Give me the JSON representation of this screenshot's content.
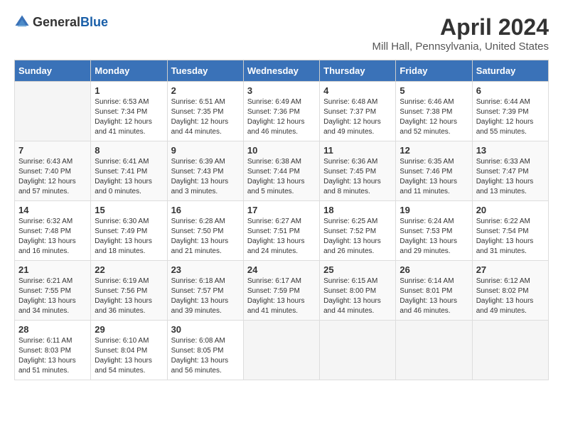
{
  "header": {
    "logo_general": "General",
    "logo_blue": "Blue",
    "title": "April 2024",
    "subtitle": "Mill Hall, Pennsylvania, United States"
  },
  "days_of_week": [
    "Sunday",
    "Monday",
    "Tuesday",
    "Wednesday",
    "Thursday",
    "Friday",
    "Saturday"
  ],
  "weeks": [
    [
      {
        "day": "",
        "sunrise": "",
        "sunset": "",
        "daylight": ""
      },
      {
        "day": "1",
        "sunrise": "Sunrise: 6:53 AM",
        "sunset": "Sunset: 7:34 PM",
        "daylight": "Daylight: 12 hours and 41 minutes."
      },
      {
        "day": "2",
        "sunrise": "Sunrise: 6:51 AM",
        "sunset": "Sunset: 7:35 PM",
        "daylight": "Daylight: 12 hours and 44 minutes."
      },
      {
        "day": "3",
        "sunrise": "Sunrise: 6:49 AM",
        "sunset": "Sunset: 7:36 PM",
        "daylight": "Daylight: 12 hours and 46 minutes."
      },
      {
        "day": "4",
        "sunrise": "Sunrise: 6:48 AM",
        "sunset": "Sunset: 7:37 PM",
        "daylight": "Daylight: 12 hours and 49 minutes."
      },
      {
        "day": "5",
        "sunrise": "Sunrise: 6:46 AM",
        "sunset": "Sunset: 7:38 PM",
        "daylight": "Daylight: 12 hours and 52 minutes."
      },
      {
        "day": "6",
        "sunrise": "Sunrise: 6:44 AM",
        "sunset": "Sunset: 7:39 PM",
        "daylight": "Daylight: 12 hours and 55 minutes."
      }
    ],
    [
      {
        "day": "7",
        "sunrise": "Sunrise: 6:43 AM",
        "sunset": "Sunset: 7:40 PM",
        "daylight": "Daylight: 12 hours and 57 minutes."
      },
      {
        "day": "8",
        "sunrise": "Sunrise: 6:41 AM",
        "sunset": "Sunset: 7:41 PM",
        "daylight": "Daylight: 13 hours and 0 minutes."
      },
      {
        "day": "9",
        "sunrise": "Sunrise: 6:39 AM",
        "sunset": "Sunset: 7:43 PM",
        "daylight": "Daylight: 13 hours and 3 minutes."
      },
      {
        "day": "10",
        "sunrise": "Sunrise: 6:38 AM",
        "sunset": "Sunset: 7:44 PM",
        "daylight": "Daylight: 13 hours and 5 minutes."
      },
      {
        "day": "11",
        "sunrise": "Sunrise: 6:36 AM",
        "sunset": "Sunset: 7:45 PM",
        "daylight": "Daylight: 13 hours and 8 minutes."
      },
      {
        "day": "12",
        "sunrise": "Sunrise: 6:35 AM",
        "sunset": "Sunset: 7:46 PM",
        "daylight": "Daylight: 13 hours and 11 minutes."
      },
      {
        "day": "13",
        "sunrise": "Sunrise: 6:33 AM",
        "sunset": "Sunset: 7:47 PM",
        "daylight": "Daylight: 13 hours and 13 minutes."
      }
    ],
    [
      {
        "day": "14",
        "sunrise": "Sunrise: 6:32 AM",
        "sunset": "Sunset: 7:48 PM",
        "daylight": "Daylight: 13 hours and 16 minutes."
      },
      {
        "day": "15",
        "sunrise": "Sunrise: 6:30 AM",
        "sunset": "Sunset: 7:49 PM",
        "daylight": "Daylight: 13 hours and 18 minutes."
      },
      {
        "day": "16",
        "sunrise": "Sunrise: 6:28 AM",
        "sunset": "Sunset: 7:50 PM",
        "daylight": "Daylight: 13 hours and 21 minutes."
      },
      {
        "day": "17",
        "sunrise": "Sunrise: 6:27 AM",
        "sunset": "Sunset: 7:51 PM",
        "daylight": "Daylight: 13 hours and 24 minutes."
      },
      {
        "day": "18",
        "sunrise": "Sunrise: 6:25 AM",
        "sunset": "Sunset: 7:52 PM",
        "daylight": "Daylight: 13 hours and 26 minutes."
      },
      {
        "day": "19",
        "sunrise": "Sunrise: 6:24 AM",
        "sunset": "Sunset: 7:53 PM",
        "daylight": "Daylight: 13 hours and 29 minutes."
      },
      {
        "day": "20",
        "sunrise": "Sunrise: 6:22 AM",
        "sunset": "Sunset: 7:54 PM",
        "daylight": "Daylight: 13 hours and 31 minutes."
      }
    ],
    [
      {
        "day": "21",
        "sunrise": "Sunrise: 6:21 AM",
        "sunset": "Sunset: 7:55 PM",
        "daylight": "Daylight: 13 hours and 34 minutes."
      },
      {
        "day": "22",
        "sunrise": "Sunrise: 6:19 AM",
        "sunset": "Sunset: 7:56 PM",
        "daylight": "Daylight: 13 hours and 36 minutes."
      },
      {
        "day": "23",
        "sunrise": "Sunrise: 6:18 AM",
        "sunset": "Sunset: 7:57 PM",
        "daylight": "Daylight: 13 hours and 39 minutes."
      },
      {
        "day": "24",
        "sunrise": "Sunrise: 6:17 AM",
        "sunset": "Sunset: 7:59 PM",
        "daylight": "Daylight: 13 hours and 41 minutes."
      },
      {
        "day": "25",
        "sunrise": "Sunrise: 6:15 AM",
        "sunset": "Sunset: 8:00 PM",
        "daylight": "Daylight: 13 hours and 44 minutes."
      },
      {
        "day": "26",
        "sunrise": "Sunrise: 6:14 AM",
        "sunset": "Sunset: 8:01 PM",
        "daylight": "Daylight: 13 hours and 46 minutes."
      },
      {
        "day": "27",
        "sunrise": "Sunrise: 6:12 AM",
        "sunset": "Sunset: 8:02 PM",
        "daylight": "Daylight: 13 hours and 49 minutes."
      }
    ],
    [
      {
        "day": "28",
        "sunrise": "Sunrise: 6:11 AM",
        "sunset": "Sunset: 8:03 PM",
        "daylight": "Daylight: 13 hours and 51 minutes."
      },
      {
        "day": "29",
        "sunrise": "Sunrise: 6:10 AM",
        "sunset": "Sunset: 8:04 PM",
        "daylight": "Daylight: 13 hours and 54 minutes."
      },
      {
        "day": "30",
        "sunrise": "Sunrise: 6:08 AM",
        "sunset": "Sunset: 8:05 PM",
        "daylight": "Daylight: 13 hours and 56 minutes."
      },
      {
        "day": "",
        "sunrise": "",
        "sunset": "",
        "daylight": ""
      },
      {
        "day": "",
        "sunrise": "",
        "sunset": "",
        "daylight": ""
      },
      {
        "day": "",
        "sunrise": "",
        "sunset": "",
        "daylight": ""
      },
      {
        "day": "",
        "sunrise": "",
        "sunset": "",
        "daylight": ""
      }
    ]
  ]
}
